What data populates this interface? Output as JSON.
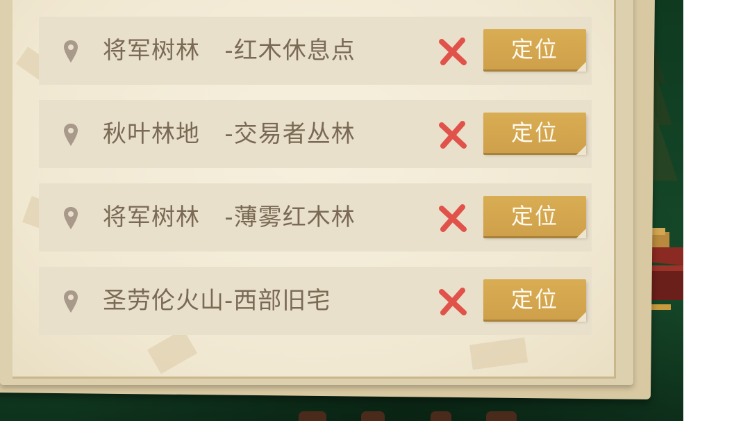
{
  "locations": [
    {
      "area": "将军树林",
      "place": "红木休息点",
      "label": "将军树林   -红木休息点",
      "locate_label": "定位"
    },
    {
      "area": "秋叶林地",
      "place": "交易者丛林",
      "label": "秋叶林地   -交易者丛林",
      "locate_label": "定位"
    },
    {
      "area": "将军树林",
      "place": "薄雾红木林",
      "label": "将军树林   -薄雾红木林",
      "locate_label": "定位"
    },
    {
      "area": "圣劳伦火山",
      "place": "西部旧宅",
      "label": "圣劳伦火山-西部旧宅",
      "locate_label": "定位"
    }
  ],
  "icons": {
    "pin": "map-pin-icon",
    "delete": "red-x-delete-icon"
  },
  "colors": {
    "paper": "#f1e8d2",
    "row": "#e9e0cb",
    "text": "#7a6a55",
    "button": "#d4a84f",
    "delete": "#e0524a",
    "background": "#123d22"
  }
}
